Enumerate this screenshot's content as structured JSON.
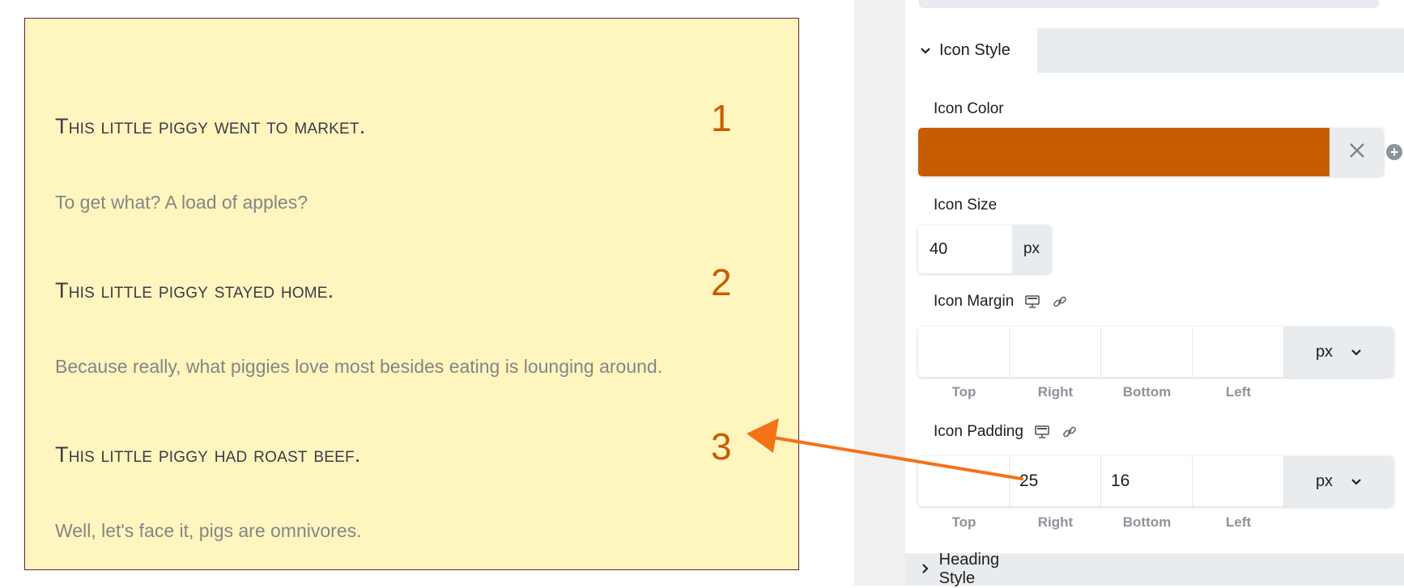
{
  "preview": {
    "items": [
      {
        "heading": "This little piggy went to market.",
        "number": "1",
        "text": "To get what? A load of apples?"
      },
      {
        "heading": "This little piggy stayed home.",
        "number": "2",
        "text": "Because really, what piggies love most besides eating is lounging around."
      },
      {
        "heading": "This little piggy had roast beef.",
        "number": "3",
        "text": "Well, let's face it, pigs are omnivores."
      }
    ],
    "colors": {
      "background": "#fff6bf",
      "border": "#6e1b30",
      "heading": "#3e3947",
      "number": "#c65d00",
      "text": "#858585"
    }
  },
  "panel": {
    "icon_style_section": {
      "title": "Icon Style",
      "caret": "expanded"
    },
    "icon_color": {
      "label": "Icon Color",
      "value": "#c65d00"
    },
    "icon_size": {
      "label": "Icon Size",
      "value": "40",
      "unit": "px"
    },
    "icon_margin": {
      "label": "Icon Margin",
      "top": "",
      "right": "",
      "bottom": "",
      "left": "",
      "unit": "px",
      "labels": {
        "top": "Top",
        "right": "Right",
        "bottom": "Bottom",
        "left": "Left"
      }
    },
    "icon_padding": {
      "label": "Icon Padding",
      "top": "",
      "right": "25",
      "bottom": "16",
      "left": "",
      "unit": "px",
      "labels": {
        "top": "Top",
        "right": "Right",
        "bottom": "Bottom",
        "left": "Left"
      }
    },
    "heading_style_section": {
      "title": "Heading Style",
      "caret": "collapsed"
    },
    "icons": {
      "responsive": "desktop-icon",
      "link": "link-icon",
      "clear": "close-icon",
      "add": "add-circle-icon",
      "caret_down": "chevron-down-icon",
      "caret_right": "chevron-right-icon"
    }
  },
  "annotation": {
    "color": "#f47216"
  }
}
